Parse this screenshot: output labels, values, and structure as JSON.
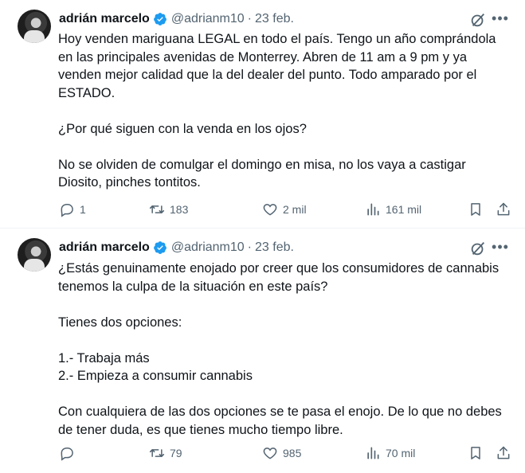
{
  "tweets": [
    {
      "author": {
        "name": "adrián marcelo",
        "handle": "@adrianm10",
        "verified": true
      },
      "date": "23 feb.",
      "paragraphs": [
        "Hoy venden mariguana LEGAL en todo el país. Tengo un año comprándola\nen las principales avenidas de Monterrey. Abren de 11 am a 9 pm y ya\nvenden mejor calidad que la del dealer del punto. Todo amparado por el\nESTADO.",
        "¿Por qué siguen con la venda en los ojos?",
        "No se olviden de comulgar el domingo en misa, no los vaya a castigar\nDiosito, pinches tontitos."
      ],
      "stats": {
        "replies": "1",
        "retweets": "183",
        "likes": "2 mil",
        "views": "161 mil"
      }
    },
    {
      "author": {
        "name": "adrián marcelo",
        "handle": "@adrianm10",
        "verified": true
      },
      "date": "23 feb.",
      "paragraphs": [
        "¿Estás genuinamente enojado por creer que los consumidores de cannabis\ntenemos la culpa de la situación en este país?",
        "Tienes dos opciones:",
        "1.- Trabaja más\n2.- Empieza a consumir cannabis",
        "Con cualquiera de las dos opciones se te pasa el enojo. De lo que no debes\nde tener duda, es que tienes mucho tiempo libre."
      ],
      "stats": {
        "replies": "",
        "retweets": "79",
        "likes": "985",
        "views": "70 mil"
      }
    }
  ],
  "colors": {
    "text": "#0f1419",
    "secondary": "#536471",
    "verified": "#1d9bf0",
    "divider": "#eff3f4"
  }
}
